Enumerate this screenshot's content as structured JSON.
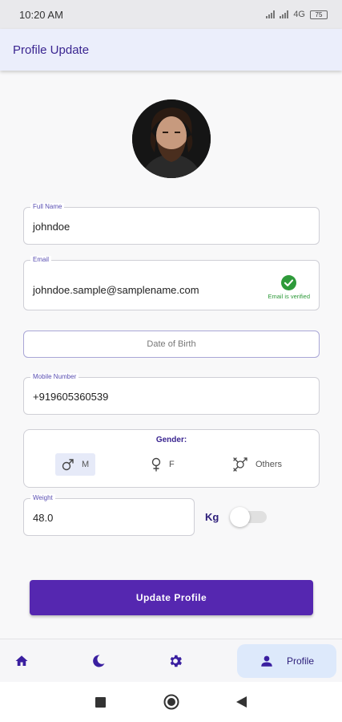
{
  "status_bar": {
    "time": "10:20 AM",
    "network": "4G",
    "battery": "75"
  },
  "app_bar": {
    "title": "Profile Update"
  },
  "form": {
    "full_name": {
      "label": "Full Name",
      "value": "johndoe"
    },
    "email": {
      "label": "Email",
      "value": "johndoe.sample@samplename.com",
      "verified_text": "Email is verified"
    },
    "dob": {
      "placeholder": "Date of Birth"
    },
    "mobile": {
      "label": "Mobile Number",
      "value": "+919605360539"
    },
    "gender": {
      "title": "Gender:",
      "options": [
        {
          "label": "M",
          "icon": "male-icon",
          "selected": true
        },
        {
          "label": "F",
          "icon": "female-icon",
          "selected": false
        },
        {
          "label": "Others",
          "icon": "transgender-icon",
          "selected": false
        }
      ]
    },
    "weight": {
      "label": "Weight",
      "value": "48.0",
      "unit": "Kg",
      "toggle_on": false
    }
  },
  "actions": {
    "update_label": "Update Profile"
  },
  "bottom_nav": {
    "items": [
      {
        "icon": "home-icon"
      },
      {
        "icon": "moon-icon"
      },
      {
        "icon": "settings-icon"
      },
      {
        "icon": "person-icon",
        "label": "Profile",
        "active": true
      }
    ]
  },
  "colors": {
    "primary": "#5527b0",
    "title_text": "#3a2590",
    "verified_green": "#2e9a3a",
    "app_bar_bg": "#ebeefb",
    "active_nav_bg": "#dde9fb"
  }
}
